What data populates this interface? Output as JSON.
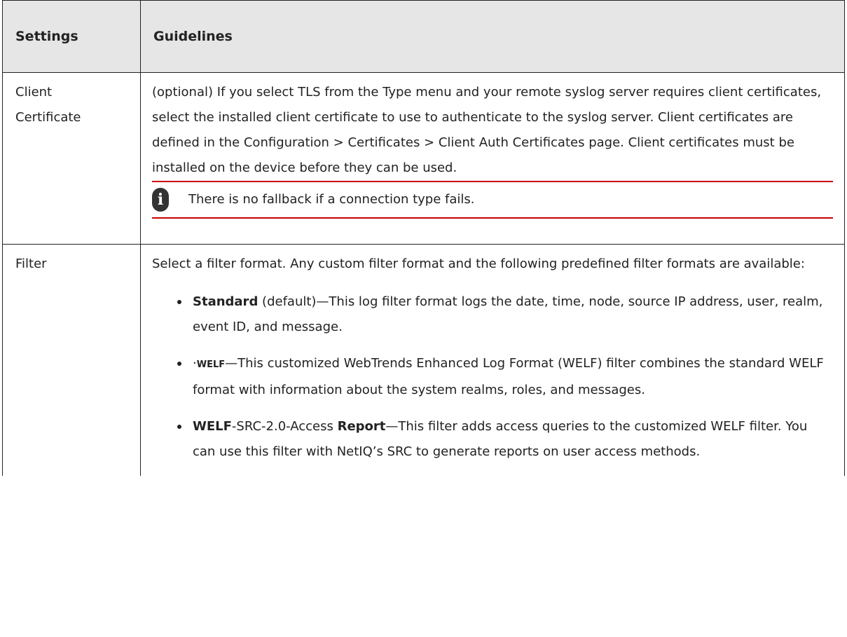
{
  "table": {
    "headers": {
      "settings": "Settings",
      "guidelines": "Guidelines"
    },
    "rows": {
      "client_certificate": {
        "setting_line1": "Client",
        "setting_line2": "Certificate",
        "description": "(optional) If you select TLS from the Type menu and your remote syslog server requires client certificates, select the installed client certificate to use to authenticate to the syslog server. Client certificates are defined in the Configuration > Certificates > Client Auth Certificates page. Client certificates must be installed on the device before they can be used.",
        "note": {
          "icon": "info-icon",
          "icon_glyph": "i",
          "text": "There is no fallback if a connection type fails."
        }
      },
      "filter": {
        "setting": "Filter",
        "description": "Select a filter format. Any custom filter format and the following predefined filter formats are available:",
        "formats": [
          {
            "name": "Standard",
            "text": " (default)—This log filter format logs the date, time, node, source IP address, user, realm, event ID, and message."
          },
          {
            "prefix": "·",
            "name": "WELF",
            "text": "—This customized WebTrends Enhanced Log Format (WELF) filter combines the standard WELF format with information about the system realms, roles, and messages."
          },
          {
            "name": "WELF",
            "middle": "-SRC-2.0-Access ",
            "name2": "Report",
            "text": "—This filter adds access queries to the customized WELF filter. You can use this filter with NetIQ’s SRC to generate reports on user access methods."
          }
        ]
      }
    }
  }
}
